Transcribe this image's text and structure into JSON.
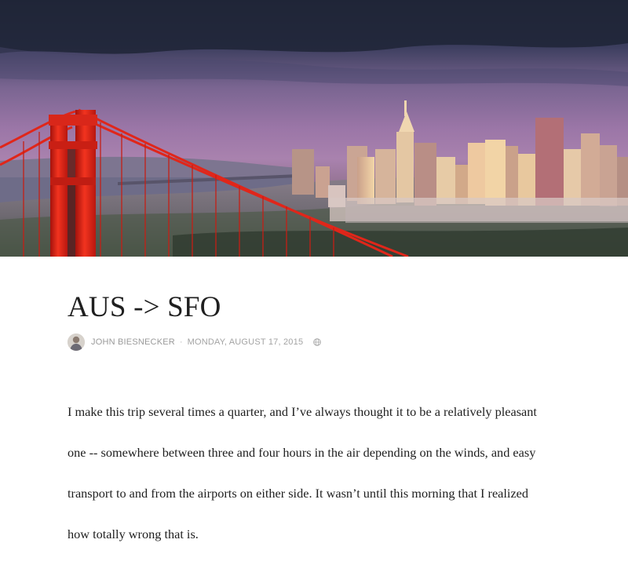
{
  "post": {
    "title": "AUS -> SFO",
    "author": "JOHN BIESNECKER",
    "separator": "·",
    "date": "MONDAY, AUGUST 17, 2015",
    "body_lines": [
      "I make this trip several times a quarter, and I’ve always thought it to be a relatively pleasant",
      "one -- somewhere between three and four hours in the air depending on the winds, and easy",
      "transport to and from the airports on either side. It wasn’t until this morning that I realized",
      "how totally wrong that is."
    ]
  },
  "icons": {
    "share": "globe-icon",
    "avatar": "author-avatar"
  },
  "colors": {
    "sky_top": "#2a3148",
    "sky_mid": "#8f6c9e",
    "bridge_red": "#d91f16",
    "title_text": "#1f1f1f",
    "meta_text": "#9a9a9a",
    "body_text": "#1e1e1e"
  }
}
